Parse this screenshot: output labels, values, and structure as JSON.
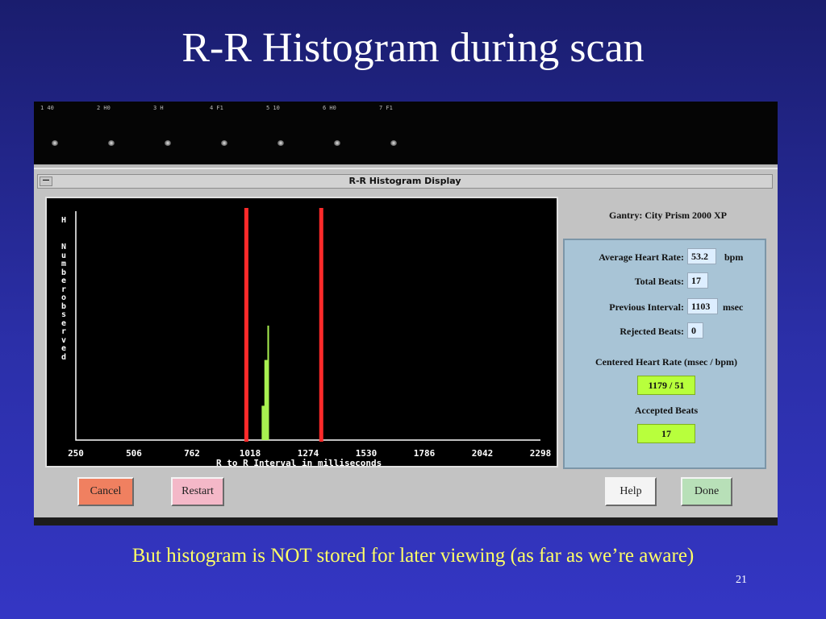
{
  "slide": {
    "title": "R-R Histogram during scan",
    "caption": "But histogram is NOT stored for later viewing (as far as we’re aware)",
    "page_number": "21"
  },
  "thumbnails": [
    {
      "label": "1 40"
    },
    {
      "label": "2 H0"
    },
    {
      "label": "3 H"
    },
    {
      "label": "4 F1"
    },
    {
      "label": "5 10"
    },
    {
      "label": "6 H0"
    },
    {
      "label": "7 F1"
    }
  ],
  "window": {
    "title": "R-R Histogram Display",
    "menu_glyph": "—"
  },
  "chart": {
    "y_top_label": "H",
    "y_title": "Number observed",
    "x_title": "R to R Interval in milliseconds",
    "bar_color": "#a8f050",
    "limit_color": "#ff2a2a",
    "limit_lines": [
      1000,
      1330
    ]
  },
  "chart_data": {
    "type": "bar",
    "title": "",
    "xlabel": "R to R Interval in milliseconds",
    "ylabel": "Number observed",
    "xlim": [
      250,
      2298
    ],
    "x_ticks": [
      "250",
      "506",
      "762",
      "1018",
      "1274",
      "1530",
      "1786",
      "2042",
      "2298"
    ],
    "x": [
      1078,
      1090,
      1098
    ],
    "values": [
      3,
      7,
      10
    ],
    "grid": false
  },
  "info": {
    "gantry": "Gantry: City Prism 2000 XP",
    "avg_hr_label": "Average Heart Rate:",
    "avg_hr_value": "53.2",
    "avg_hr_unit": "bpm",
    "total_beats_label": "Total Beats:",
    "total_beats_value": "17",
    "prev_interval_label": "Previous Interval:",
    "prev_interval_value": "1103",
    "prev_interval_unit": "msec",
    "rejected_label": "Rejected Beats:",
    "rejected_value": "0",
    "centered_label": "Centered Heart Rate (msec / bpm)",
    "centered_value": "1179 / 51",
    "accepted_label": "Accepted Beats",
    "accepted_value": "17"
  },
  "buttons": {
    "cancel": "Cancel",
    "restart": "Restart",
    "help": "Help",
    "done": "Done"
  },
  "colors": {
    "cancel": "#f08060",
    "restart": "#f4b8c8",
    "help": "#f4f4f4",
    "done": "#b8e0b8",
    "accent_green": "#b8ff3c"
  }
}
